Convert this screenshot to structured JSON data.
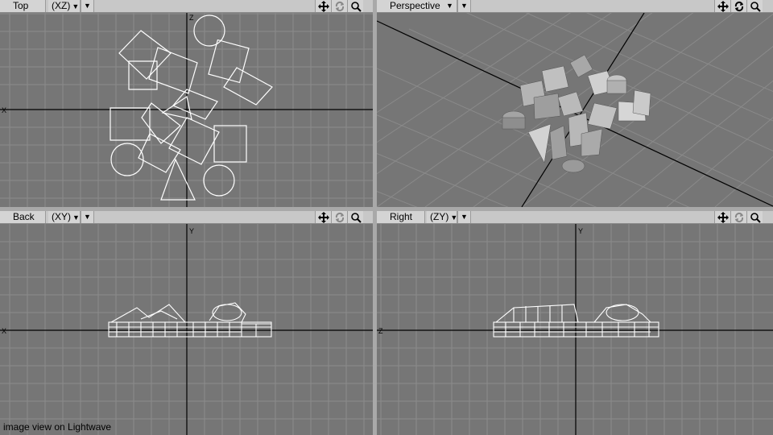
{
  "viewports": {
    "top": {
      "title": "Top",
      "axis": "(XZ)",
      "axis_h": "X",
      "axis_v": "Z"
    },
    "persp": {
      "title": "Perspective"
    },
    "back": {
      "title": "Back",
      "axis": "(XY)",
      "axis_h": "X",
      "axis_v": "Y"
    },
    "right": {
      "title": "Right",
      "axis": "(ZY)",
      "axis_h": "Z",
      "axis_v": "Y"
    }
  },
  "controls": {
    "dropdown_caret": "▼",
    "menu_caret": "▼",
    "move_icon": "move-icon",
    "rotate_icon": "rotate-icon",
    "zoom_icon": "zoom-icon"
  },
  "caption": "image view on Lightwave",
  "colors": {
    "viewport_bg": "#767676",
    "grid": "#8c8c8c",
    "axis": "#000000",
    "wire": "#ffffff",
    "solid": "#bcbcbc"
  }
}
